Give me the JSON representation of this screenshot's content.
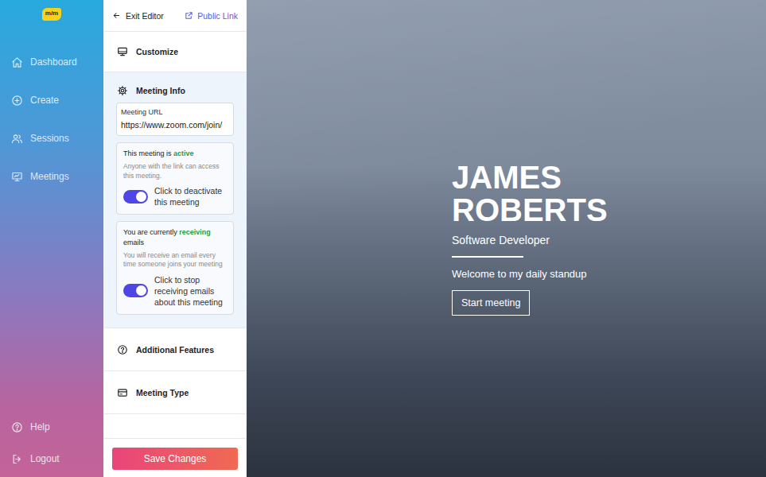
{
  "logo": {
    "text": "m/m"
  },
  "nav": {
    "items": [
      {
        "label": "Dashboard",
        "selected": false
      },
      {
        "label": "Create",
        "selected": false
      },
      {
        "label": "Sessions",
        "selected": false
      },
      {
        "label": "Meetings",
        "selected": false
      }
    ],
    "footer_items": [
      {
        "label": "Help"
      },
      {
        "label": "Logout"
      }
    ]
  },
  "editor": {
    "exit_label": "Exit Editor",
    "public_link": "Public Link",
    "sections": [
      {
        "title": "Customize",
        "expanded": false
      },
      {
        "title": "Meeting Info",
        "expanded": true
      },
      {
        "title": "Additional Features",
        "expanded": false
      },
      {
        "title": "Meeting Type",
        "expanded": false
      }
    ],
    "meeting_info": {
      "url_field": {
        "label": "Meeting URL",
        "value": "https://www.zoom.com/join/"
      },
      "toggles": [
        {
          "status_prefix": "This meeting is",
          "status": "active",
          "description": "Anyone with the link can access this meeting.",
          "toggle_label": "Click to deactivate this meeting",
          "on": true
        },
        {
          "status_prefix": "You are currently",
          "status": "receiving",
          "status_suffix": "emails",
          "description": "You will receive an email every time someone joins your meeting",
          "toggle_label": "Click to stop receiving emails about this meeting",
          "on": true
        }
      ]
    },
    "save_button": "Save Changes"
  },
  "preview": {
    "name": "JAMES ROBERTS",
    "subtitle": "Software Developer",
    "welcome": "Welcome to my daily standup",
    "button": "Start meeting"
  }
}
